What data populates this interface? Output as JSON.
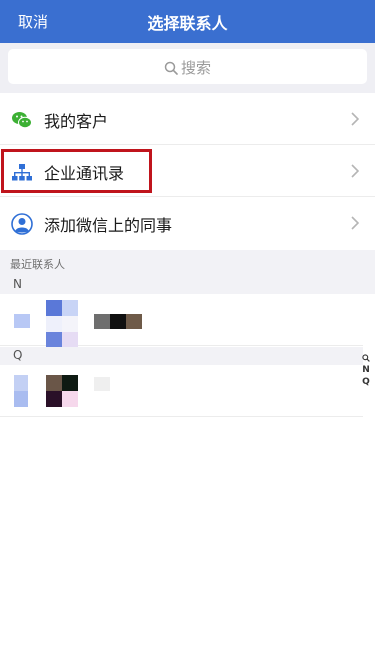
{
  "nav": {
    "cancel_label": "取消",
    "title": "选择联系人"
  },
  "search": {
    "placeholder": "搜索"
  },
  "menu": {
    "my_customers": "我的客户",
    "enterprise_directory": "企业通讯录",
    "add_wechat_colleagues": "添加微信上的同事"
  },
  "recent": {
    "header": "最近联系人",
    "groups": [
      "N",
      "Q"
    ]
  },
  "index_bar": [
    "N",
    "Q"
  ],
  "colors": {
    "nav_bg": "#3a6fd0",
    "highlight": "#c0141c",
    "wechat_green": "#3cb034",
    "directory_blue": "#2f6fd6"
  }
}
